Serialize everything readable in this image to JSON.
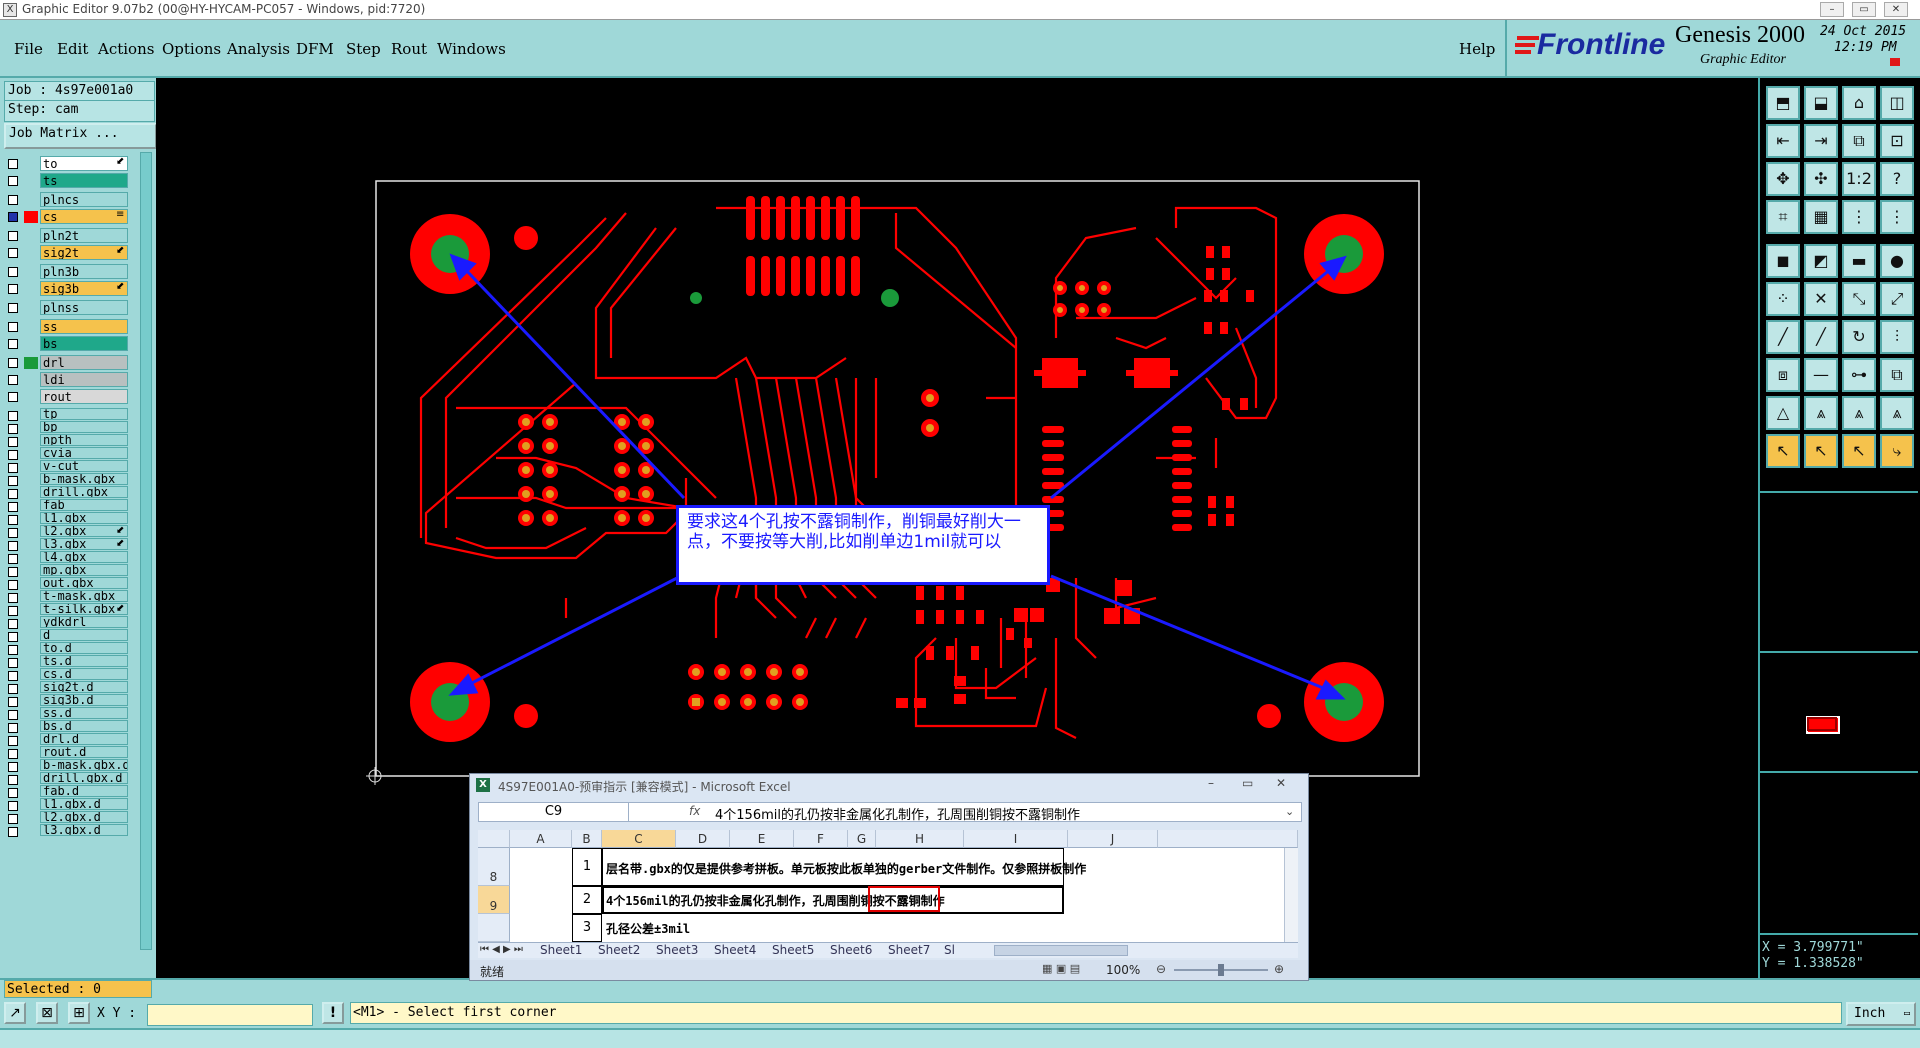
{
  "window": {
    "title": "Graphic Editor 9.07b2 (00@HY-HYCAM-PC057 - Windows, pid:7720)",
    "controls": [
      "–",
      "▭",
      "✕"
    ]
  },
  "menu": {
    "items": [
      "File",
      "Edit",
      "Actions",
      "Options",
      "Analysis",
      "DFM",
      "Step",
      "Rout",
      "Windows"
    ],
    "help": "Help"
  },
  "brand": {
    "logo": "Frontline",
    "product": "Genesis 2000",
    "subtitle": "Graphic Editor",
    "date": "24 Oct 2015",
    "time": "12:19 PM"
  },
  "job": {
    "job_label": "Job : 4s97e001a0",
    "step_label": "Step: cam",
    "matrix_button": "Job Matrix ..."
  },
  "layers": [
    {
      "name": "to",
      "color": "#ffffff",
      "checked": false,
      "mark": "⬋"
    },
    {
      "name": "ts",
      "color": "#1fa88a",
      "checked": false,
      "mark": ""
    },
    {
      "name": "plncs",
      "color": "#9fd8d8",
      "checked": false,
      "mark": ""
    },
    {
      "name": "cs",
      "color": "#f5c24c",
      "checked": true,
      "mark": "≡",
      "swatch": "#ff0000"
    },
    {
      "name": "pln2t",
      "color": "#9fd8d8",
      "checked": false,
      "mark": ""
    },
    {
      "name": "sig2t",
      "color": "#f5c24c",
      "checked": false,
      "mark": "⬋"
    },
    {
      "name": "pln3b",
      "color": "#9fd8d8",
      "checked": false,
      "mark": ""
    },
    {
      "name": "sig3b",
      "color": "#f5c24c",
      "checked": false,
      "mark": "⬋"
    },
    {
      "name": "plnss",
      "color": "#9fd8d8",
      "checked": false,
      "mark": ""
    },
    {
      "name": "ss",
      "color": "#f5c24c",
      "checked": false,
      "mark": ""
    },
    {
      "name": "bs",
      "color": "#1fa88a",
      "checked": false,
      "mark": ""
    },
    {
      "name": "drl",
      "color": "#b8c0c0",
      "checked": false,
      "mark": "",
      "swatch": "#1a9a3a"
    },
    {
      "name": "ldi",
      "color": "#b8c0c0",
      "checked": false,
      "mark": ""
    },
    {
      "name": "rout",
      "color": "#d8d8d8",
      "checked": false,
      "mark": ""
    },
    {
      "name": "tp",
      "color": "#9fd8d8",
      "checked": false,
      "mark": ""
    },
    {
      "name": "bp",
      "color": "#9fd8d8",
      "checked": false,
      "mark": ""
    },
    {
      "name": "npth",
      "color": "#9fd8d8",
      "checked": false,
      "mark": ""
    },
    {
      "name": "cvia",
      "color": "#9fd8d8",
      "checked": false,
      "mark": ""
    },
    {
      "name": "v-cut",
      "color": "#9fd8d8",
      "checked": false,
      "mark": ""
    },
    {
      "name": "b-mask.gbx",
      "color": "#9fd8d8",
      "checked": false,
      "mark": ""
    },
    {
      "name": "drill.gbx",
      "color": "#9fd8d8",
      "checked": false,
      "mark": ""
    },
    {
      "name": "fab",
      "color": "#9fd8d8",
      "checked": false,
      "mark": ""
    },
    {
      "name": "l1.gbx",
      "color": "#9fd8d8",
      "checked": false,
      "mark": ""
    },
    {
      "name": "l2.gbx",
      "color": "#9fd8d8",
      "checked": false,
      "mark": "⬋"
    },
    {
      "name": "l3.gbx",
      "color": "#9fd8d8",
      "checked": false,
      "mark": "⬋"
    },
    {
      "name": "l4.gbx",
      "color": "#9fd8d8",
      "checked": false,
      "mark": ""
    },
    {
      "name": "mp.gbx",
      "color": "#9fd8d8",
      "checked": false,
      "mark": ""
    },
    {
      "name": "out.gbx",
      "color": "#9fd8d8",
      "checked": false,
      "mark": ""
    },
    {
      "name": "t-mask.gbx",
      "color": "#9fd8d8",
      "checked": false,
      "mark": ""
    },
    {
      "name": "t-silk.gbx",
      "color": "#9fd8d8",
      "checked": false,
      "mark": "⬋"
    },
    {
      "name": "ydkdrl",
      "color": "#9fd8d8",
      "checked": false,
      "mark": ""
    },
    {
      "name": "d",
      "color": "#9fd8d8",
      "checked": false,
      "mark": ""
    },
    {
      "name": "to.d",
      "color": "#9fd8d8",
      "checked": false,
      "mark": ""
    },
    {
      "name": "ts.d",
      "color": "#9fd8d8",
      "checked": false,
      "mark": ""
    },
    {
      "name": "cs.d",
      "color": "#9fd8d8",
      "checked": false,
      "mark": ""
    },
    {
      "name": "sig2t.d",
      "color": "#9fd8d8",
      "checked": false,
      "mark": ""
    },
    {
      "name": "sig3b.d",
      "color": "#9fd8d8",
      "checked": false,
      "mark": ""
    },
    {
      "name": "ss.d",
      "color": "#9fd8d8",
      "checked": false,
      "mark": ""
    },
    {
      "name": "bs.d",
      "color": "#9fd8d8",
      "checked": false,
      "mark": ""
    },
    {
      "name": "drl.d",
      "color": "#9fd8d8",
      "checked": false,
      "mark": ""
    },
    {
      "name": "rout.d",
      "color": "#9fd8d8",
      "checked": false,
      "mark": ""
    },
    {
      "name": "b-mask.gbx.d",
      "color": "#9fd8d8",
      "checked": false,
      "mark": ""
    },
    {
      "name": "drill.gbx.d",
      "color": "#9fd8d8",
      "checked": false,
      "mark": ""
    },
    {
      "name": "fab.d",
      "color": "#9fd8d8",
      "checked": false,
      "mark": ""
    },
    {
      "name": "l1.gbx.d",
      "color": "#9fd8d8",
      "checked": false,
      "mark": ""
    },
    {
      "name": "l2.gbx.d",
      "color": "#9fd8d8",
      "checked": false,
      "mark": ""
    },
    {
      "name": "l3.gbx.d",
      "color": "#9fd8d8",
      "checked": false,
      "mark": ""
    }
  ],
  "annotation": {
    "note": "要求这4个孔按不露铜制作，削铜最好削大一点，不要按等大削,比如削单边1mil就可以"
  },
  "readout": {
    "x": "X = 3.799771\"",
    "y": "Y = 1.338528\""
  },
  "status": {
    "selected": "Selected : 0",
    "xy_label": "X Y :",
    "xy_value": "",
    "prompt": "<M1> - Select first corner",
    "units": "Inch"
  },
  "excel": {
    "title": "4S97E001A0-预审指示  [兼容模式] - Microsoft Excel",
    "name_box": "C9",
    "fx": "fx",
    "formula": "4个156mil的孔仍按非金属化孔制作，孔周围削铜按不露铜制作",
    "columns": [
      "A",
      "B",
      "C",
      "D",
      "E",
      "F",
      "G",
      "H",
      "I",
      "J"
    ],
    "rows": [
      {
        "row": "8",
        "num": "1",
        "text": "层名带.gbx的仅是提供参考拼板。单元板按此板单独的gerber文件制作。仅参照拼板制作"
      },
      {
        "row": "9",
        "num": "2",
        "text": "4个156mil的孔仍按非金属化孔制作，孔周围削铜按不露铜制作"
      },
      {
        "row": "",
        "num": "3",
        "text": "孔径公差±3mil"
      }
    ],
    "sheets": [
      "Sheet1",
      "Sheet2",
      "Sheet3",
      "Sheet4",
      "Sheet5",
      "Sheet6",
      "Sheet7",
      "Sl"
    ],
    "status_text": "就绪",
    "zoom": "100%"
  },
  "colors": {
    "panel": "#9fd8d8",
    "copper": "#ff0000",
    "drill": "#1a9a3a",
    "annotation": "#1a1aff"
  }
}
